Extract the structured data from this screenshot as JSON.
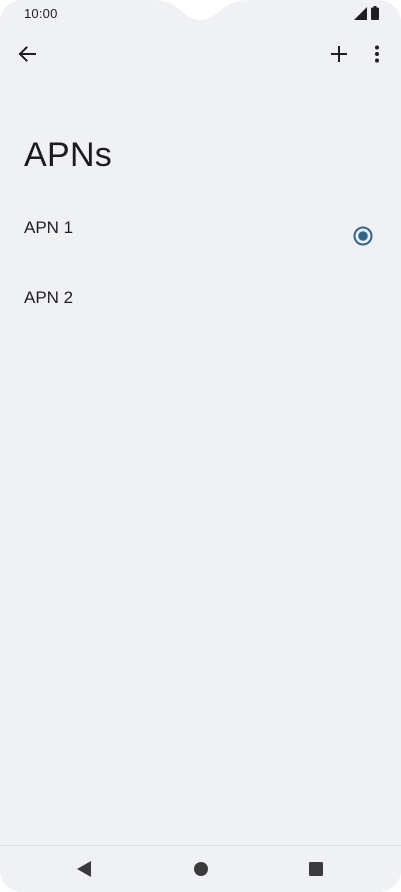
{
  "status_bar": {
    "time": "10:00",
    "icons": [
      "signal-icon",
      "battery-icon"
    ]
  },
  "toolbar": {
    "back_icon": "arrow-left-icon",
    "add_icon": "plus-icon",
    "more_icon": "more-vert-icon"
  },
  "page": {
    "title": "APNs"
  },
  "apns": [
    {
      "label": "APN 1",
      "selected": true
    },
    {
      "label": "APN 2",
      "selected": false
    }
  ],
  "colors": {
    "background": "#eff1f4",
    "accent": "#2f6690",
    "text": "#1f1f1f"
  },
  "nav_bar": {
    "icons": [
      "back-triangle-icon",
      "home-circle-icon",
      "recents-square-icon"
    ]
  }
}
